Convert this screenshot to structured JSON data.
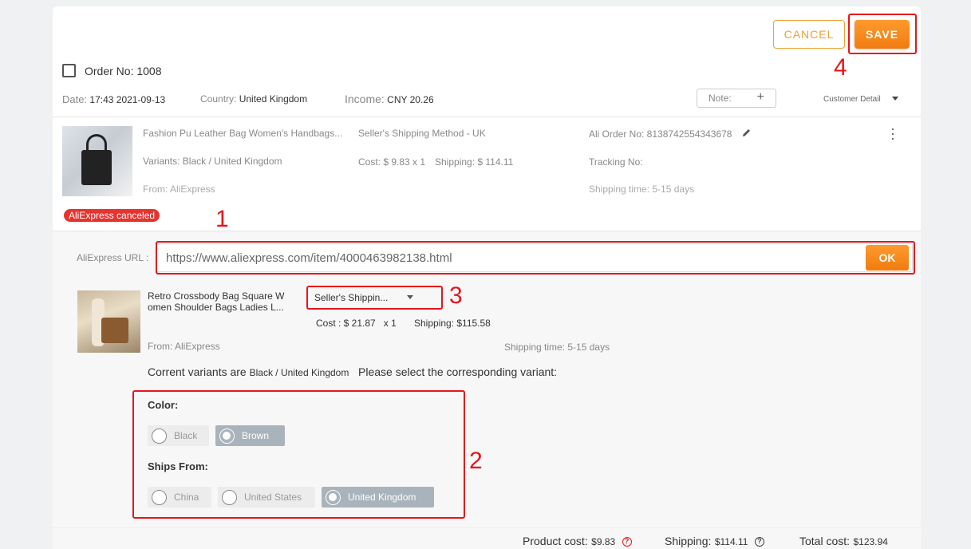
{
  "header": {
    "cancel_label": "CANCEL",
    "save_label": "SAVE"
  },
  "order": {
    "title": "Order No: 1008",
    "date_label": "Date:",
    "date_value": "17:43 2021-09-13",
    "country_label": "Country:",
    "country_value": "United Kingdom",
    "income_label": "Income:",
    "income_value": "CNY 20.26",
    "note_label": "Note:",
    "customer_detail_label": "Customer Detail"
  },
  "item": {
    "name": "Fashion Pu Leather Bag Women's Handbags...",
    "variants": "Variants: Black / United Kingdom",
    "from": "From: AliExpress",
    "shipping_method": "Seller's Shipping Method - UK",
    "cost": "Cost: $ 9.83 x 1",
    "shipping": "Shipping: $ 114.11",
    "ali_order_no": "Ali Order No: 8138742554343678",
    "tracking_no": "Tracking No:",
    "shipping_time": "Shipping time: 5-15 days",
    "status_badge": "AliExpress canceled"
  },
  "replace": {
    "url_label": "AliExpress URL :",
    "url_value": "https://www.aliexpress.com/item/4000463982138.html",
    "ok_label": "OK",
    "product_name_line1": "Retro Crossbody Bag Square W",
    "product_name_line2": "omen Shoulder Bags Ladies L...",
    "shipping_select_value": "Seller's Shippin...",
    "cost": "Cost : $ 21.87",
    "qty": "x 1",
    "shipping": "Shipping: $115.58",
    "from": "From: AliExpress",
    "shipping_time": "Shipping time: 5-15 days",
    "variants_prefix": "Corrent variants are",
    "variants_current": "Black / United Kingdom",
    "variants_suffix": "Please select the corresponding variant:",
    "color_label": "Color:",
    "color_options": [
      "Black",
      "Brown"
    ],
    "color_selected": "Brown",
    "ships_from_label": "Ships From:",
    "ships_from_options": [
      "China",
      "United States",
      "United Kingdom"
    ],
    "ships_from_selected": "United Kingdom"
  },
  "footer": {
    "product_cost_label": "Product cost:",
    "product_cost_value": "$9.83",
    "shipping_label": "Shipping:",
    "shipping_value": "$114.11",
    "total_label": "Total cost:",
    "total_value": "$123.94"
  },
  "annotations": {
    "a1": "1",
    "a2": "2",
    "a3": "3",
    "a4": "4"
  },
  "colors": {
    "accent": "#f07c10",
    "annotation_red": "#e8141a",
    "badge_red": "#e8322e",
    "selected_option": "#a9b3bb"
  }
}
